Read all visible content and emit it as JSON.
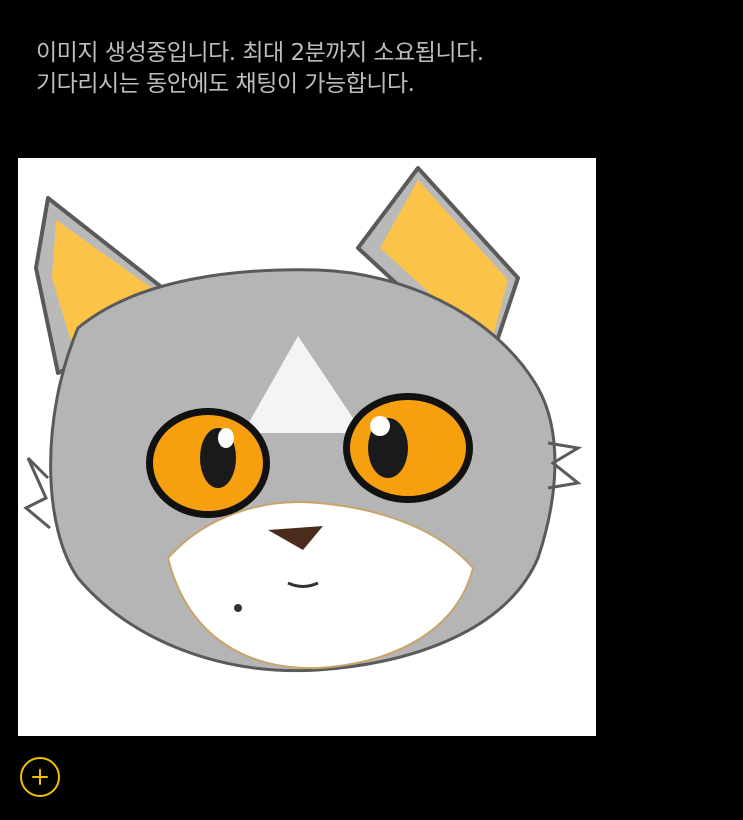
{
  "chat": {
    "status_line_1": "이미지 생성중입니다. 최대 2분까지 소요됩니다.",
    "status_line_2": "기다리시는 동안에도 채팅이 가능합니다."
  },
  "generated_image": {
    "subject": "cartoon-cat-illustration",
    "colors": {
      "fur": "#b5b5b5",
      "ear_inner": "#fcc349",
      "eye_iris": "#f6a00f",
      "muzzle": "#ffffff",
      "outline": "#5a5a5a",
      "nose": "#4a2b1c"
    }
  },
  "composer": {
    "add_icon": "plus-icon",
    "accent_color": "#f2c200"
  }
}
